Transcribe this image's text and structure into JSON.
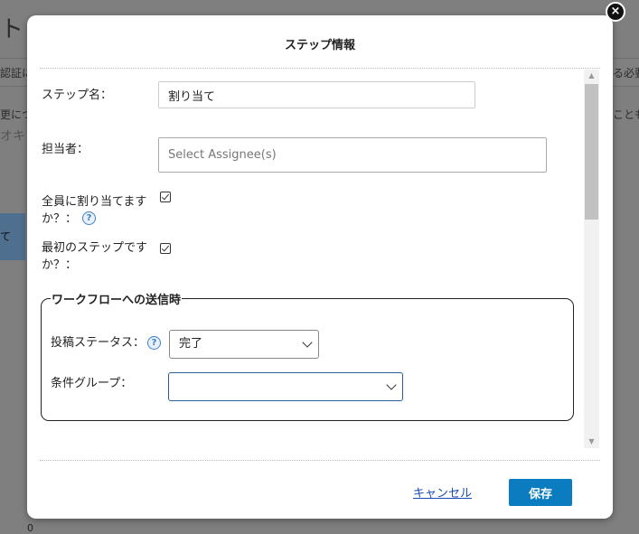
{
  "background": {
    "title_fragment": "ト",
    "row1_left": "認証に",
    "row1_right": "る必要",
    "row2_left": "更につ",
    "row2_right": "ことも",
    "row3_left": "オキ",
    "button_fragment": "て",
    "footer_number": "0"
  },
  "dialog": {
    "title": "ステップ情報",
    "close_label": "×",
    "fields": {
      "step_name": {
        "label": "ステップ名：",
        "value": "割り当て"
      },
      "assignee": {
        "label": "担当者：",
        "placeholder": "Select Assignee(s)"
      },
      "assign_all": {
        "label": "全員に割り当てます\nか？：",
        "checked": true,
        "help_icon": "?"
      },
      "first_step": {
        "label": "最初のステップです\nか？：",
        "checked": true
      }
    },
    "workflow_group": {
      "legend": "ワークフローへの送信時",
      "post_status": {
        "label": "投稿ステータス：",
        "help_icon": "?",
        "value": "完了"
      },
      "condition_group": {
        "label": "条件グループ：",
        "value": ""
      }
    },
    "footer": {
      "cancel_label": "キャンセル",
      "save_label": "保存"
    }
  },
  "colors": {
    "overlay": "#7f7f7f",
    "save_button": "#0c7cc0",
    "link": "#1a4db3",
    "focused_border": "#2b5e9a"
  }
}
